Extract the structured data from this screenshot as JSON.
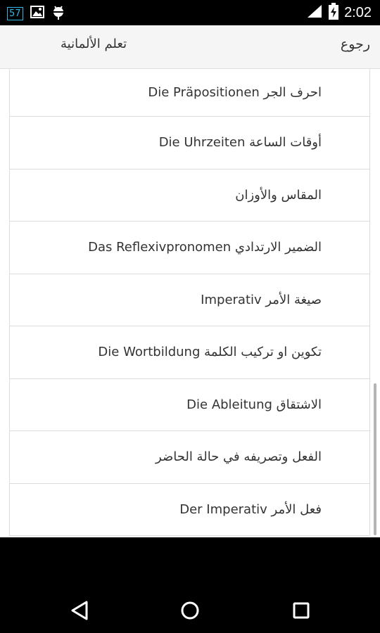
{
  "status_bar": {
    "notification_count": "57",
    "time": "2:02"
  },
  "app_bar": {
    "back_label": "رجوع",
    "title": "تعلم الألمانية"
  },
  "list": {
    "items": [
      {
        "label": "احرف الجر Die Präpositionen"
      },
      {
        "label": "Die Uhrzeiten أوقات الساعة"
      },
      {
        "label": "المقاس والأوزان"
      },
      {
        "label": "Das Reflexivpronomen الضمير الارتدادي"
      },
      {
        "label": "صيغة الأمر Imperativ"
      },
      {
        "label": "تكوين او تركيب الكلمة Die Wortbildung"
      },
      {
        "label": "Die Ableitung الاشتقاق"
      },
      {
        "label": "الفعل وتصريفه في حالة الحاضر"
      },
      {
        "label": "Der Imperativ فعل الأمر"
      }
    ]
  },
  "colors": {
    "app_bar_bg": "#f5f5f5",
    "divider": "#dcdcdc",
    "text": "#333333",
    "notification_accent": "#33b5e5"
  }
}
